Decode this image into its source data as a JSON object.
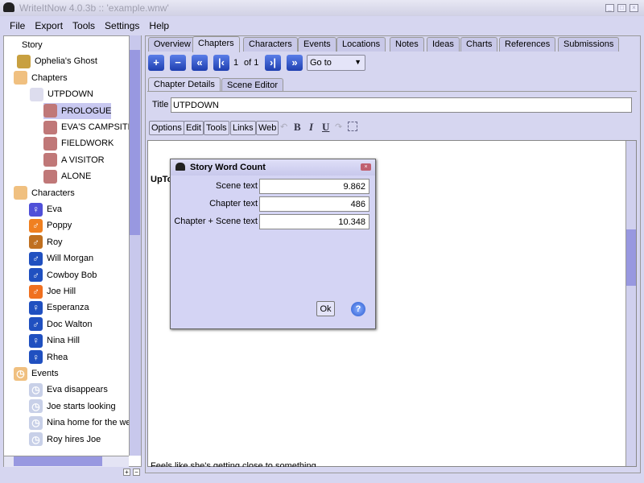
{
  "window": {
    "title": "WriteItNow 4.0.3b :: 'example.wnw'"
  },
  "menu": [
    "File",
    "Export",
    "Tools",
    "Settings",
    "Help"
  ],
  "tree": {
    "root": "Story",
    "story": "Ophelia's Ghost",
    "chapters_label": "Chapters",
    "chapter": "UTPDOWN",
    "scenes": [
      "PROLOGUE",
      "EVA'S CAMPSITE",
      "FIELDWORK",
      "A VISITOR",
      "ALONE"
    ],
    "characters_label": "Characters",
    "characters": [
      {
        "name": "Eva",
        "gender": "female",
        "color": "#5050d8"
      },
      {
        "name": "Poppy",
        "gender": "male",
        "color": "#f08020"
      },
      {
        "name": "Roy",
        "gender": "male",
        "color": "#c07020"
      },
      {
        "name": "Will Morgan",
        "gender": "male",
        "color": "#2050c0"
      },
      {
        "name": "Cowboy Bob",
        "gender": "male",
        "color": "#2050c0"
      },
      {
        "name": "Joe Hill",
        "gender": "male",
        "color": "#f07020"
      },
      {
        "name": "Esperanza",
        "gender": "female",
        "color": "#2050c0"
      },
      {
        "name": "Doc Walton",
        "gender": "male",
        "color": "#2050c0"
      },
      {
        "name": "Nina Hill",
        "gender": "female",
        "color": "#2050c0"
      },
      {
        "name": "Rhea",
        "gender": "female",
        "color": "#2050c0"
      }
    ],
    "events_label": "Events",
    "events": [
      "Eva disappears",
      "Joe starts looking",
      "Nina home for the week",
      "Roy hires Joe"
    ]
  },
  "tabs": [
    "Overview",
    "Chapters",
    "Characters",
    "Events",
    "Locations",
    "Notes",
    "Ideas",
    "Charts",
    "References",
    "Submissions"
  ],
  "nav": {
    "current": "1",
    "of": "of 1",
    "goto": "Go to"
  },
  "subtabs": [
    "Chapter Details",
    "Scene Editor"
  ],
  "title_field": {
    "label": "Title",
    "value": "UTPDOWN"
  },
  "format_buttons": [
    "Options",
    "Edit",
    "Tools",
    "Links",
    "Web"
  ],
  "editor": {
    "heading": "UpTo",
    "bottom_text": "Feels like she's getting close to something"
  },
  "dialog": {
    "title": "Story Word Count",
    "rows": [
      {
        "label": "Scene text",
        "value": "9.862"
      },
      {
        "label": "Chapter text",
        "value": "486"
      },
      {
        "label": "Chapter + Scene text",
        "value": "10.348"
      }
    ],
    "ok": "Ok",
    "help": "?"
  }
}
